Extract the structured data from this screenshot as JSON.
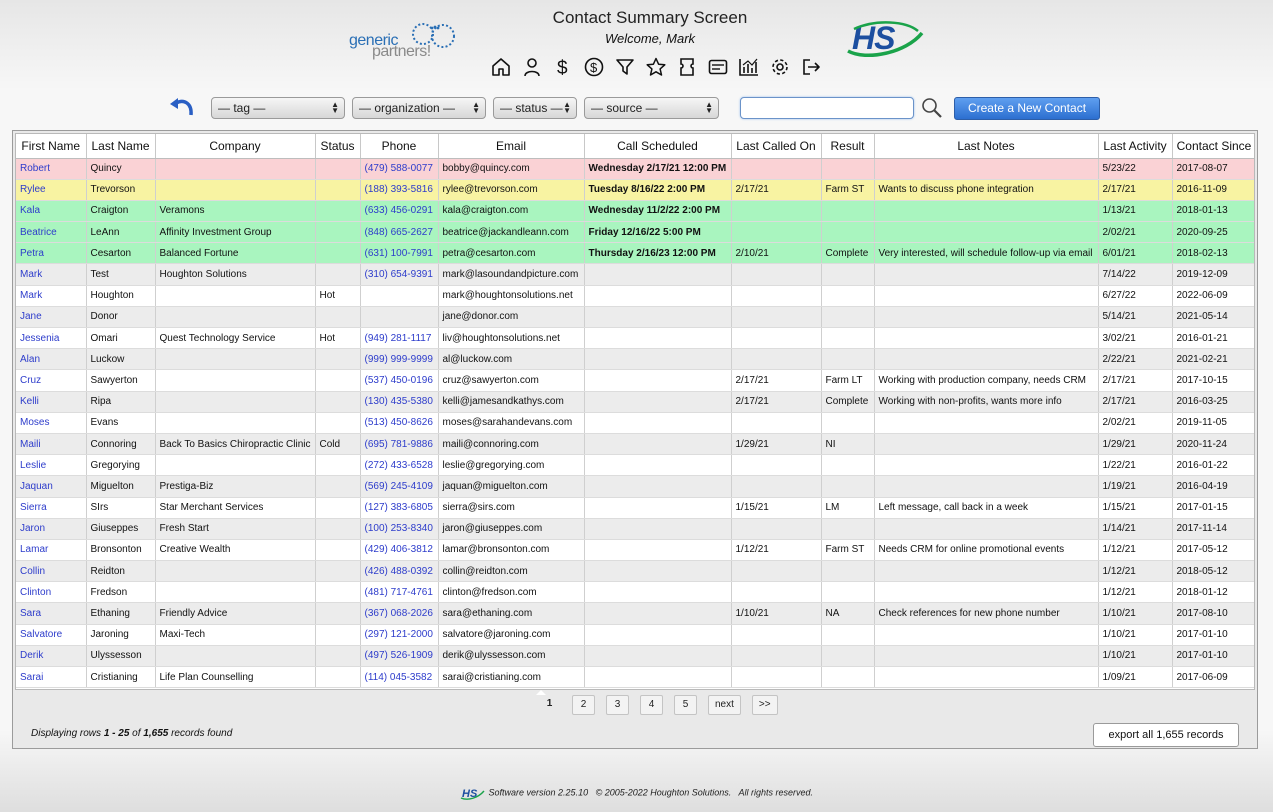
{
  "header": {
    "title": "Contact Summary Screen",
    "welcome": "Welcome, Mark",
    "logo_left_line1": "generic",
    "logo_left_line2": "partners!",
    "logo_right": "HS"
  },
  "nav_icons": [
    "home-icon",
    "user-icon",
    "dollar-icon",
    "refresh-dollar-icon",
    "filter-icon",
    "star-icon",
    "ticket-icon",
    "card-icon",
    "chart-icon",
    "gear-icon",
    "logout-icon"
  ],
  "filters": {
    "tag": "— tag —",
    "organization": "— organization —",
    "status": "— status —",
    "source": "— source —",
    "search_value": "",
    "new_contact_label": "Create a New Contact"
  },
  "table": {
    "columns": [
      "First Name",
      "Last Name",
      "Company",
      "Status",
      "Phone",
      "Email",
      "Call Scheduled",
      "Last Called On",
      "Result",
      "Last Notes",
      "Last Activity",
      "Contact Since"
    ],
    "rows": [
      {
        "first": "Robert",
        "last": "Quincy",
        "company": "",
        "status": "",
        "phone": "(479) 588-0077",
        "email": "bobby@quincy.com",
        "sched": "Wednesday 2/17/21 12:00 PM",
        "called": "",
        "result": "",
        "notes": "",
        "activity": "5/23/22",
        "since": "2017-08-07",
        "color": "pink"
      },
      {
        "first": "Rylee",
        "last": "Trevorson",
        "company": "",
        "status": "",
        "phone": "(188) 393-5816",
        "email": "rylee@trevorson.com",
        "sched": "Tuesday 8/16/22 2:00 PM",
        "called": "2/17/21",
        "result": "Farm ST",
        "notes": "Wants to discuss phone integration",
        "activity": "2/17/21",
        "since": "2016-11-09",
        "color": "yellow"
      },
      {
        "first": "Kala",
        "last": "Craigton",
        "company": "Veramons",
        "status": "",
        "phone": "(633) 456-0291",
        "email": "kala@craigton.com",
        "sched": "Wednesday 11/2/22 2:00 PM",
        "called": "",
        "result": "",
        "notes": "",
        "activity": "1/13/21",
        "since": "2018-01-13",
        "color": "green"
      },
      {
        "first": "Beatrice",
        "last": "LeAnn",
        "company": "Affinity Investment Group",
        "status": "",
        "phone": "(848) 665-2627",
        "email": "beatrice@jackandleann.com",
        "sched": "Friday 12/16/22 5:00 PM",
        "called": "",
        "result": "",
        "notes": "",
        "activity": "2/02/21",
        "since": "2020-09-25",
        "color": "green"
      },
      {
        "first": "Petra",
        "last": "Cesarton",
        "company": "Balanced Fortune",
        "status": "",
        "phone": "(631) 100-7991",
        "email": "petra@cesarton.com",
        "sched": "Thursday 2/16/23 12:00 PM",
        "called": "2/10/21",
        "result": "Complete",
        "notes": "Very interested, will schedule follow-up via email",
        "activity": "6/01/21",
        "since": "2018-02-13",
        "color": "green"
      },
      {
        "first": "Mark",
        "last": "Test",
        "company": "Houghton Solutions",
        "status": "",
        "phone": "(310) 654-9391",
        "email": "mark@lasoundandpicture.com",
        "sched": "",
        "called": "",
        "result": "",
        "notes": "",
        "activity": "7/14/22",
        "since": "2019-12-09",
        "color": "gray"
      },
      {
        "first": "Mark",
        "last": "Houghton",
        "company": "",
        "status": "Hot",
        "phone": "",
        "email": "mark@houghtonsolutions.net",
        "sched": "",
        "called": "",
        "result": "",
        "notes": "",
        "activity": "6/27/22",
        "since": "2022-06-09",
        "color": "white"
      },
      {
        "first": "Jane",
        "last": "Donor",
        "company": "",
        "status": "",
        "phone": "",
        "email": "jane@donor.com",
        "sched": "",
        "called": "",
        "result": "",
        "notes": "",
        "activity": "5/14/21",
        "since": "2021-05-14",
        "color": "gray"
      },
      {
        "first": "Jessenia",
        "last": "Omari",
        "company": "Quest Technology Service",
        "status": "Hot",
        "phone": "(949) 281-1117",
        "email": "liv@houghtonsolutions.net",
        "sched": "",
        "called": "",
        "result": "",
        "notes": "",
        "activity": "3/02/21",
        "since": "2016-01-21",
        "color": "white"
      },
      {
        "first": "Alan",
        "last": "Luckow",
        "company": "",
        "status": "",
        "phone": "(999) 999-9999",
        "email": "al@luckow.com",
        "sched": "",
        "called": "",
        "result": "",
        "notes": "",
        "activity": "2/22/21",
        "since": "2021-02-21",
        "color": "gray"
      },
      {
        "first": "Cruz",
        "last": "Sawyerton",
        "company": "",
        "status": "",
        "phone": "(537) 450-0196",
        "email": "cruz@sawyerton.com",
        "sched": "",
        "called": "2/17/21",
        "result": "Farm LT",
        "notes": "Working with production company, needs CRM",
        "activity": "2/17/21",
        "since": "2017-10-15",
        "color": "white"
      },
      {
        "first": "Kelli",
        "last": "Ripa",
        "company": "",
        "status": "",
        "phone": "(130) 435-5380",
        "email": "kelli@jamesandkathys.com",
        "sched": "",
        "called": "2/17/21",
        "result": "Complete",
        "notes": "Working with non-profits, wants more info",
        "activity": "2/17/21",
        "since": "2016-03-25",
        "color": "gray"
      },
      {
        "first": "Moses",
        "last": "Evans",
        "company": "",
        "status": "",
        "phone": "(513) 450-8626",
        "email": "moses@sarahandevans.com",
        "sched": "",
        "called": "",
        "result": "",
        "notes": "",
        "activity": "2/02/21",
        "since": "2019-11-05",
        "color": "white"
      },
      {
        "first": "Maili",
        "last": "Connoring",
        "company": "Back To Basics Chiropractic Clinic",
        "status": "Cold",
        "phone": "(695) 781-9886",
        "email": "maili@connoring.com",
        "sched": "",
        "called": "1/29/21",
        "result": "NI",
        "notes": "",
        "activity": "1/29/21",
        "since": "2020-11-24",
        "color": "gray"
      },
      {
        "first": "Leslie",
        "last": "Gregorying",
        "company": "",
        "status": "",
        "phone": "(272) 433-6528",
        "email": "leslie@gregorying.com",
        "sched": "",
        "called": "",
        "result": "",
        "notes": "",
        "activity": "1/22/21",
        "since": "2016-01-22",
        "color": "white"
      },
      {
        "first": "Jaquan",
        "last": "Miguelton",
        "company": "Prestiga-Biz",
        "status": "",
        "phone": "(569) 245-4109",
        "email": "jaquan@miguelton.com",
        "sched": "",
        "called": "",
        "result": "",
        "notes": "",
        "activity": "1/19/21",
        "since": "2016-04-19",
        "color": "gray"
      },
      {
        "first": "Sierra",
        "last": "SIrs",
        "company": "Star Merchant Services",
        "status": "",
        "phone": "(127) 383-6805",
        "email": "sierra@sirs.com",
        "sched": "",
        "called": "1/15/21",
        "result": "LM",
        "notes": "Left message, call back in a week",
        "activity": "1/15/21",
        "since": "2017-01-15",
        "color": "white"
      },
      {
        "first": "Jaron",
        "last": "Giuseppes",
        "company": "Fresh Start",
        "status": "",
        "phone": "(100) 253-8340",
        "email": "jaron@giuseppes.com",
        "sched": "",
        "called": "",
        "result": "",
        "notes": "",
        "activity": "1/14/21",
        "since": "2017-11-14",
        "color": "gray"
      },
      {
        "first": "Lamar",
        "last": "Bronsonton",
        "company": "Creative Wealth",
        "status": "",
        "phone": "(429) 406-3812",
        "email": "lamar@bronsonton.com",
        "sched": "",
        "called": "1/12/21",
        "result": "Farm ST",
        "notes": "Needs CRM for online promotional events",
        "activity": "1/12/21",
        "since": "2017-05-12",
        "color": "white"
      },
      {
        "first": "Collin",
        "last": "Reidton",
        "company": "",
        "status": "",
        "phone": "(426) 488-0392",
        "email": "collin@reidton.com",
        "sched": "",
        "called": "",
        "result": "",
        "notes": "",
        "activity": "1/12/21",
        "since": "2018-05-12",
        "color": "gray"
      },
      {
        "first": "Clinton",
        "last": "Fredson",
        "company": "",
        "status": "",
        "phone": "(481) 717-4761",
        "email": "clinton@fredson.com",
        "sched": "",
        "called": "",
        "result": "",
        "notes": "",
        "activity": "1/12/21",
        "since": "2018-01-12",
        "color": "white"
      },
      {
        "first": "Sara",
        "last": "Ethaning",
        "company": "Friendly Advice",
        "status": "",
        "phone": "(367) 068-2026",
        "email": "sara@ethaning.com",
        "sched": "",
        "called": "1/10/21",
        "result": "NA",
        "notes": "Check references for new phone number",
        "activity": "1/10/21",
        "since": "2017-08-10",
        "color": "gray"
      },
      {
        "first": "Salvatore",
        "last": "Jaroning",
        "company": "Maxi-Tech",
        "status": "",
        "phone": "(297) 121-2000",
        "email": "salvatore@jaroning.com",
        "sched": "",
        "called": "",
        "result": "",
        "notes": "",
        "activity": "1/10/21",
        "since": "2017-01-10",
        "color": "white"
      },
      {
        "first": "Derik",
        "last": "Ulyssesson",
        "company": "",
        "status": "",
        "phone": "(497) 526-1909",
        "email": "derik@ulyssesson.com",
        "sched": "",
        "called": "",
        "result": "",
        "notes": "",
        "activity": "1/10/21",
        "since": "2017-01-10",
        "color": "gray"
      },
      {
        "first": "Sarai",
        "last": "Cristianing",
        "company": "Life Plan Counselling",
        "status": "",
        "phone": "(114) 045-3582",
        "email": "sarai@cristianing.com",
        "sched": "",
        "called": "",
        "result": "",
        "notes": "",
        "activity": "1/09/21",
        "since": "2017-06-09",
        "color": "white"
      }
    ]
  },
  "pager": {
    "pages": [
      "1",
      "2",
      "3",
      "4",
      "5",
      "next",
      ">>"
    ],
    "current": "1",
    "records_prefix": "Displaying rows ",
    "records_range": "1 - 25",
    "records_of": " of ",
    "records_total": "1,655",
    "records_suffix": " records found",
    "export_label": "export all 1,655 records"
  },
  "footer": {
    "logo": "HS",
    "text": "Software version 2.25.10   © 2005-2022 Houghton Solutions.   All rights reserved."
  },
  "colors": {
    "link": "#2d3ccb",
    "row_pink": "#fad2d5",
    "row_yellow": "#f8f3a2",
    "row_green": "#a9f5bf",
    "row_gray": "#ececec",
    "button_blue": "#2c6fd0",
    "hs_logo_blue": "#1c4fa0",
    "hs_logo_green": "#1aa34a"
  }
}
